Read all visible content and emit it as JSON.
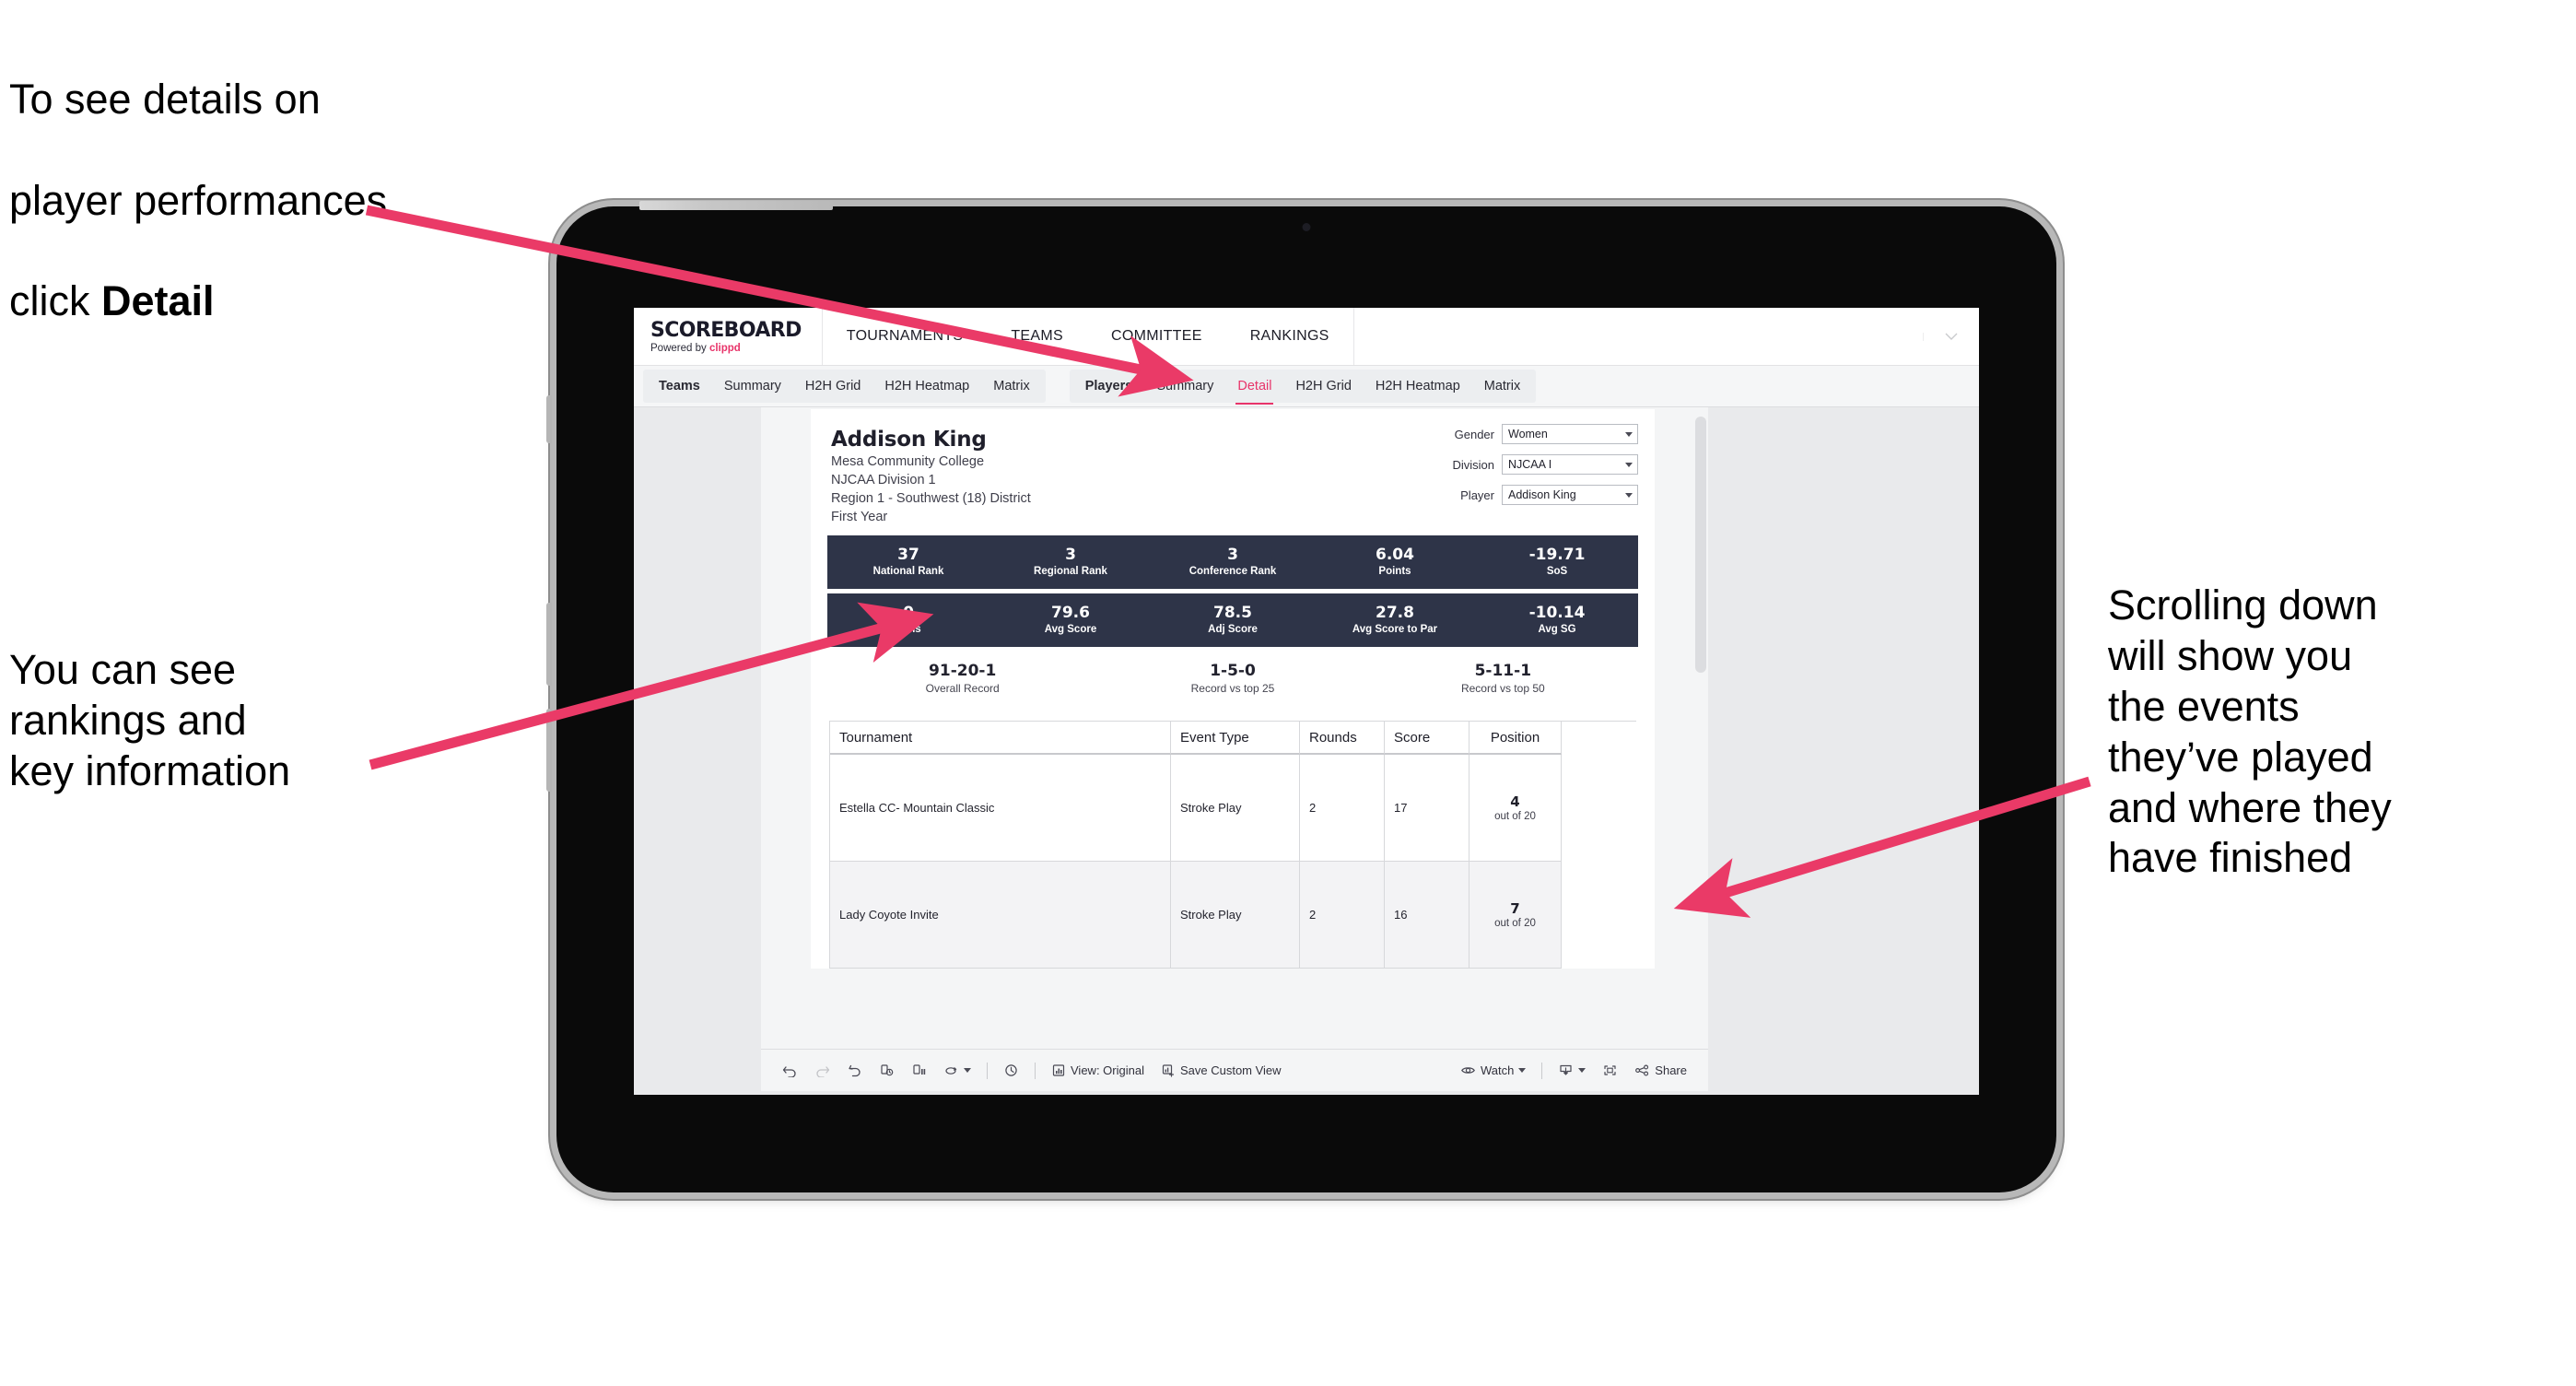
{
  "annotations": {
    "top_left": {
      "line1": "To see details on",
      "line2": "player performances",
      "line3_prefix": "click ",
      "line3_bold": "Detail"
    },
    "mid_left": "You can see\nrankings and\nkey information",
    "right": "Scrolling down\nwill show you\nthe events\nthey’ve played\nand where they\nhave finished",
    "arrow_color": "#ea3a67"
  },
  "app": {
    "brand": {
      "title": "SCOREBOARD",
      "powered_prefix": "Powered by ",
      "powered_accent": "clippd"
    },
    "topnav": [
      {
        "label": "TOURNAMENTS"
      },
      {
        "label": "TEAMS"
      },
      {
        "label": "COMMITTEE"
      },
      {
        "label": "RANKINGS"
      }
    ],
    "tabstrip": {
      "group_teams": [
        {
          "label": "Teams",
          "lead": true,
          "active": false
        },
        {
          "label": "Summary",
          "lead": false,
          "active": false
        },
        {
          "label": "H2H Grid",
          "lead": false,
          "active": false
        },
        {
          "label": "H2H Heatmap",
          "lead": false,
          "active": false
        },
        {
          "label": "Matrix",
          "lead": false,
          "active": false
        }
      ],
      "group_players": [
        {
          "label": "Players",
          "lead": true,
          "active": false
        },
        {
          "label": "Summary",
          "lead": false,
          "active": false
        },
        {
          "label": "Detail",
          "lead": false,
          "active": true
        },
        {
          "label": "H2H Grid",
          "lead": false,
          "active": false
        },
        {
          "label": "H2H Heatmap",
          "lead": false,
          "active": false
        },
        {
          "label": "Matrix",
          "lead": false,
          "active": false
        }
      ],
      "active_color": "#e8346a"
    }
  },
  "player": {
    "name": "Addison King",
    "school": "Mesa Community College",
    "division": "NJCAA Division 1",
    "region": "Region 1 - Southwest (18) District",
    "class_year": "First Year"
  },
  "filters": [
    {
      "label": "Gender",
      "value": "Women"
    },
    {
      "label": "Division",
      "value": "NJCAA I"
    },
    {
      "label": "Player",
      "value": "Addison King"
    }
  ],
  "kpi_bar_1": {
    "bg": "#2e3448",
    "cells": [
      {
        "value": "37",
        "label": "National Rank"
      },
      {
        "value": "3",
        "label": "Regional Rank"
      },
      {
        "value": "3",
        "label": "Conference Rank"
      },
      {
        "value": "6.04",
        "label": "Points"
      },
      {
        "value": "-19.71",
        "label": "SoS"
      }
    ]
  },
  "kpi_bar_2": {
    "bg": "#2e3448",
    "cells": [
      {
        "value": "0",
        "label": "Wins"
      },
      {
        "value": "79.6",
        "label": "Avg Score"
      },
      {
        "value": "78.5",
        "label": "Adj Score"
      },
      {
        "value": "27.8",
        "label": "Avg Score to Par"
      },
      {
        "value": "-10.14",
        "label": "Avg SG"
      }
    ]
  },
  "records": [
    {
      "value": "91-20-1",
      "label": "Overall Record"
    },
    {
      "value": "1-5-0",
      "label": "Record vs top 25"
    },
    {
      "value": "5-11-1",
      "label": "Record vs top 50"
    }
  ],
  "tournament_table": {
    "columns": [
      "Tournament",
      "Event Type",
      "Rounds",
      "Score",
      "Position"
    ],
    "rows": [
      {
        "tournament": "Estella CC- Mountain Classic",
        "event_type": "Stroke Play",
        "rounds": "2",
        "score": "17",
        "position_num": "4",
        "position_of": "out of 20"
      },
      {
        "tournament": "Lady Coyote Invite",
        "event_type": "Stroke Play",
        "rounds": "2",
        "score": "16",
        "position_num": "7",
        "position_of": "out of 20"
      }
    ]
  },
  "toolbar": {
    "view_original": "View: Original",
    "save_custom_view": "Save Custom View",
    "watch": "Watch",
    "share": "Share"
  }
}
